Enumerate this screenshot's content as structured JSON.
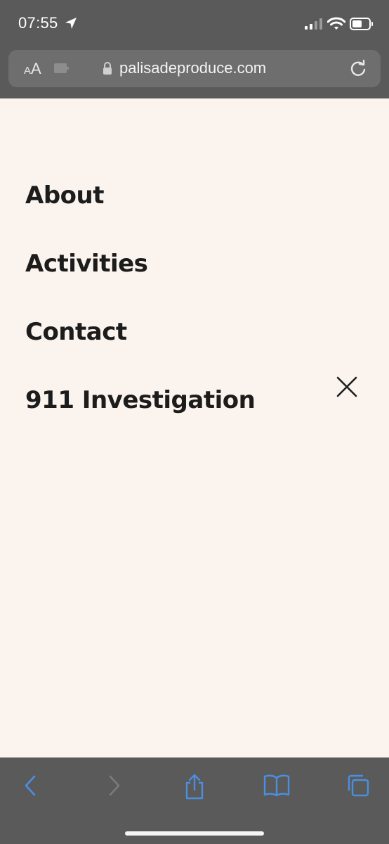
{
  "status_bar": {
    "time": "07:55",
    "icons": [
      "location-arrow-icon",
      "cellular-signal-icon",
      "wifi-icon",
      "battery-icon"
    ]
  },
  "browser": {
    "text_size_button": {
      "small": "A",
      "large": "A"
    },
    "url": "palisadeproduce.com"
  },
  "menu": {
    "items": [
      {
        "label": "About"
      },
      {
        "label": "Activities"
      },
      {
        "label": "Contact"
      },
      {
        "label": "911 Investigation"
      }
    ]
  },
  "toolbar": {
    "buttons": [
      "back-icon",
      "forward-icon",
      "share-icon",
      "bookmarks-icon",
      "tabs-icon"
    ]
  },
  "colors": {
    "page_background": "#fbf4ee",
    "menu_text": "#1c1c1c",
    "browser_chrome": "#5a5a5a",
    "toolbar_accent": "#4a90e2"
  }
}
